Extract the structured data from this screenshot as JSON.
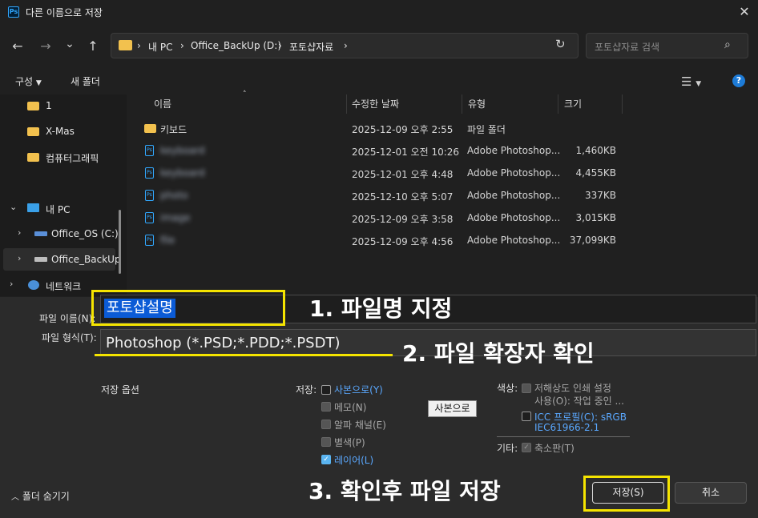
{
  "window": {
    "title": "다른 이름으로 저장",
    "app_icon": "Ps"
  },
  "nav": {
    "back": "←",
    "forward": "→",
    "recent": "⌄",
    "up": "↑",
    "breadcrumb": [
      "내 PC",
      "Office_BackUp (D:)",
      "포토샵자료"
    ],
    "search_placeholder": "포토샵자료 검색"
  },
  "toolbar": {
    "organize": "구성",
    "new_folder": "새 폴더"
  },
  "sidebar": {
    "items": [
      {
        "label": "1"
      },
      {
        "label": "X-Mas"
      },
      {
        "label": "컴퓨터그래픽"
      },
      {
        "label": "내 PC"
      },
      {
        "label": "Office_OS (C:)"
      },
      {
        "label": "Office_BackUp"
      },
      {
        "label": "네트워크"
      }
    ]
  },
  "columns": [
    "이름",
    "수정한 날짜",
    "유형",
    "크기"
  ],
  "files": [
    {
      "name": "키보드",
      "date": "2025-12-09 오후 2:55",
      "type": "파일 폴더",
      "size": "",
      "kind": "folder"
    },
    {
      "name": "keyboard",
      "date": "2025-12-01 오전 10:26",
      "type": "Adobe Photoshop...",
      "size": "1,460KB",
      "kind": "psd"
    },
    {
      "name": "keyboard",
      "date": "2025-12-01 오후 4:48",
      "type": "Adobe Photoshop...",
      "size": "4,455KB",
      "kind": "psd"
    },
    {
      "name": "photo",
      "date": "2025-12-10 오후 5:07",
      "type": "Adobe Photoshop...",
      "size": "337KB",
      "kind": "psd"
    },
    {
      "name": "image",
      "date": "2025-12-09 오후 3:58",
      "type": "Adobe Photoshop...",
      "size": "3,015KB",
      "kind": "psd"
    },
    {
      "name": "file",
      "date": "2025-12-09 오후 4:56",
      "type": "Adobe Photoshop...",
      "size": "37,099KB",
      "kind": "psd"
    }
  ],
  "form": {
    "filename_label": "파일 이름(N):",
    "filename_value": "포토샵설명",
    "filetype_label": "파일 형식(T):",
    "filetype_value": "Photoshop (*.PSD;*.PDD;*.PSDT)"
  },
  "annotations": {
    "step1": "1. 파일명 지정",
    "step2": "2. 파일 확장자 확인",
    "step3": "3. 확인후 파일 저장",
    "highlight_color": "#f5e400"
  },
  "options": {
    "save_options_label": "저장 옵션",
    "save_label": "저장:",
    "as_copy": "사본으로(Y)",
    "notes": "메모(N)",
    "alpha": "알파 채널(E)",
    "spot": "별색(P)",
    "layers": "레이어(L)",
    "copy_button": "사본으로",
    "color_label": "색상:",
    "low_res_1": "저해상도 인쇄 설정",
    "low_res_2": "사용(O): 작업 중인 ...",
    "icc_1": "ICC 프로필(C): sRGB",
    "icc_2": "IEC61966-2.1",
    "other_label": "기타:",
    "thumbnail": "축소판(T)"
  },
  "footer": {
    "hide_folders": "폴더 숨기기",
    "save": "저장(S)",
    "cancel": "취소"
  }
}
